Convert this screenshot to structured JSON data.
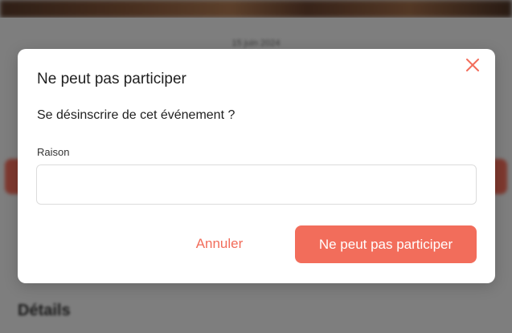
{
  "background": {
    "date_text": "15 juin 2024",
    "details_heading": "Détails"
  },
  "modal": {
    "title": "Ne peut pas participer",
    "question": "Se désinscrire de cet événement ?",
    "reason_label": "Raison",
    "reason_value": "",
    "reason_placeholder": "",
    "cancel_label": "Annuler",
    "confirm_label": "Ne peut pas participer",
    "close_icon": "close-icon"
  },
  "colors": {
    "accent": "#f26d5b",
    "overlay": "rgba(0,0,0,0.48)",
    "modal_bg": "#ffffff"
  }
}
